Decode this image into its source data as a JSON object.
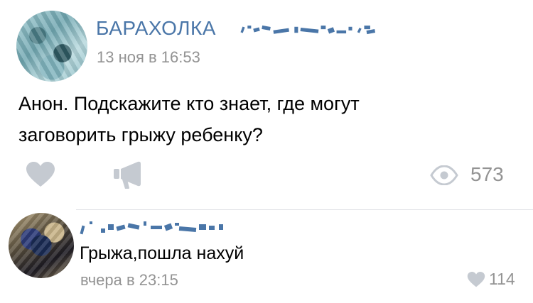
{
  "post": {
    "author": "БАРАХОЛКА",
    "date": "13 ноя в 16:53",
    "text_line1": "Анон. Подскажите кто знает, где могут",
    "text_line2": "заговорить грыжу ребенку?",
    "views": "573"
  },
  "comment": {
    "text": "Грыжа,пошла нахуй",
    "date": "вчера в 23:15",
    "likes": "114"
  },
  "colors": {
    "link": "#4a76a8",
    "muted": "#939393",
    "icon": "#c5cad1",
    "divider": "#e1e3e6"
  },
  "icons": {
    "like": "heart-icon",
    "share": "megaphone-icon",
    "views": "eye-icon",
    "comment_like": "heart-icon"
  }
}
